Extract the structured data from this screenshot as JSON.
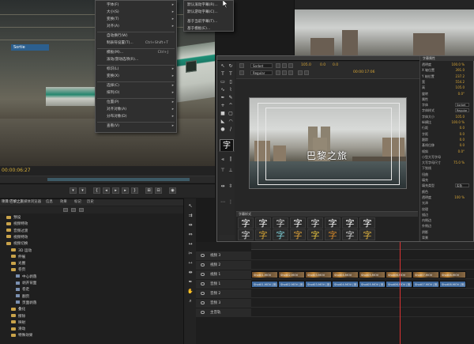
{
  "source_monitor": {
    "sign_text": "Sortie",
    "timecode": "00:00:06:27"
  },
  "context_menu": {
    "items": [
      {
        "label": "字体(F)",
        "shortcut": "",
        "submenu": true
      },
      {
        "label": "大小(S)",
        "shortcut": "",
        "submenu": true
      },
      {
        "label": "变换(T)",
        "shortcut": "",
        "submenu": true
      },
      {
        "label": "对齐(A)",
        "shortcut": "",
        "submenu": true
      },
      {
        "label": "自动换行(W)",
        "shortcut": "",
        "submenu": false
      },
      {
        "label": "制表符设置(T)...",
        "shortcut": "Ctrl+Shift+T",
        "submenu": false
      },
      {
        "label": "模板(M)...",
        "shortcut": "Ctrl+J",
        "submenu": false
      },
      {
        "label": "滚动/游动选项(R)...",
        "shortcut": "",
        "submenu": false
      },
      {
        "label": "标识(L)",
        "shortcut": "",
        "submenu": true
      },
      {
        "label": "变换(X)",
        "shortcut": "",
        "submenu": true
      },
      {
        "label": "选择(C)",
        "shortcut": "",
        "submenu": true
      },
      {
        "label": "排列(O)",
        "shortcut": "",
        "submenu": true
      },
      {
        "label": "位置(P)",
        "shortcut": "",
        "submenu": true
      },
      {
        "label": "对齐对象(A)",
        "shortcut": "",
        "submenu": true
      },
      {
        "label": "分布对象(D)",
        "shortcut": "",
        "submenu": true
      },
      {
        "label": "查看(V)",
        "shortcut": "",
        "submenu": true
      }
    ]
  },
  "sub_menu": {
    "items": [
      {
        "label": "默认滚动字幕(R)..."
      },
      {
        "label": "默认游动字幕(C)..."
      },
      {
        "label": "基于当前字幕(T)..."
      },
      {
        "label": "基于模板(E)..."
      }
    ]
  },
  "title_designer": {
    "font_family": "Sorbet",
    "font_style": "Regular",
    "font_size": "105.0",
    "kerning": "0.0",
    "leading": "0.0",
    "timecode": "00:00:17:06",
    "canvas_text": "巴黎之旅",
    "style_glyph": "字",
    "styles_header": "字幕样式",
    "properties_header": "字幕属性",
    "properties": [
      {
        "label": "透明度",
        "value": "100.0 %"
      },
      {
        "label": "X 轴位置",
        "value": "391.0"
      },
      {
        "label": "Y 轴位置",
        "value": "237.2"
      },
      {
        "label": "宽",
        "value": "554.2"
      },
      {
        "label": "高",
        "value": "105.0"
      },
      {
        "label": "旋转",
        "value": "0.0°"
      },
      {
        "label": "属性",
        "value": ""
      },
      {
        "label": "字体",
        "value": "Sorbet"
      },
      {
        "label": "字体样式",
        "value": "Regular"
      },
      {
        "label": "字体大小",
        "value": "105.0"
      },
      {
        "label": "纵横比",
        "value": "100.0 %"
      },
      {
        "label": "行距",
        "value": "0.0"
      },
      {
        "label": "字距",
        "value": "0.0"
      },
      {
        "label": "跟踪",
        "value": "0.0"
      },
      {
        "label": "基线位移",
        "value": "0.0"
      },
      {
        "label": "倾斜",
        "value": "0.0°"
      },
      {
        "label": "小型大写字母",
        "value": ""
      },
      {
        "label": "大写字母尺寸",
        "value": "75.0 %"
      },
      {
        "label": "下划线",
        "value": ""
      },
      {
        "label": "扭曲",
        "value": ""
      },
      {
        "label": "填充",
        "value": ""
      },
      {
        "label": "填充类型",
        "value": "实色"
      },
      {
        "label": "颜色",
        "value": ""
      },
      {
        "label": "透明度",
        "value": "100 %"
      },
      {
        "label": "光泽",
        "value": ""
      },
      {
        "label": "纹理",
        "value": ""
      },
      {
        "label": "描边",
        "value": ""
      },
      {
        "label": "内侧边",
        "value": ""
      },
      {
        "label": "外侧边",
        "value": ""
      },
      {
        "label": "阴影",
        "value": ""
      },
      {
        "label": "背景",
        "value": ""
      }
    ]
  },
  "project_panel": {
    "tabs": [
      "项目:巴黎之旅",
      "媒体浏览器",
      "信息",
      "效果",
      "标记",
      "历史"
    ],
    "folders": [
      {
        "label": "预设",
        "indent": 0,
        "type": "folder"
      },
      {
        "label": "视频特效",
        "indent": 0,
        "type": "folder"
      },
      {
        "label": "音频过渡",
        "indent": 0,
        "type": "folder"
      },
      {
        "label": "视频特效",
        "indent": 0,
        "type": "folder"
      },
      {
        "label": "视频切换",
        "indent": 0,
        "type": "folder"
      },
      {
        "label": "3D 运动",
        "indent": 1,
        "type": "folder"
      },
      {
        "label": "伸展",
        "indent": 1,
        "type": "folder"
      },
      {
        "label": "光圈",
        "indent": 1,
        "type": "folder"
      },
      {
        "label": "卷页",
        "indent": 1,
        "type": "folder"
      },
      {
        "label": "中心剥落",
        "indent": 2,
        "type": "item"
      },
      {
        "label": "剥开背面",
        "indent": 2,
        "type": "item"
      },
      {
        "label": "卷走",
        "indent": 2,
        "type": "item"
      },
      {
        "label": "翻页",
        "indent": 2,
        "type": "item"
      },
      {
        "label": "页面剥落",
        "indent": 2,
        "type": "item"
      },
      {
        "label": "叠化",
        "indent": 1,
        "type": "folder"
      },
      {
        "label": "擦除",
        "indent": 1,
        "type": "folder"
      },
      {
        "label": "映射",
        "indent": 1,
        "type": "folder"
      },
      {
        "label": "滑动",
        "indent": 1,
        "type": "folder"
      },
      {
        "label": "特殊效果",
        "indent": 1,
        "type": "folder"
      }
    ]
  },
  "timeline": {
    "tracks": [
      {
        "label": "视频 3",
        "kind": "video"
      },
      {
        "label": "视频 2",
        "kind": "video"
      },
      {
        "label": "视频 1",
        "kind": "video"
      },
      {
        "label": "音频 1",
        "kind": "audio"
      },
      {
        "label": "音频 2",
        "kind": "audio"
      },
      {
        "label": "音频 3",
        "kind": "audio"
      },
      {
        "label": "主音轨",
        "kind": "master"
      }
    ],
    "video_clips": [
      "Shot01.MOV",
      "Shot02.MOV",
      "Shot03.MOV",
      "Shot04.MOV",
      "Shot05.MOV",
      "Shot06.MOV",
      "Shot07.MOV",
      "Shot08.MOV"
    ],
    "audio_clips": [
      "Shot01.MOV [音]",
      "Shot02.MOV [音]",
      "Shot03.MOV [音]",
      "Shot04.MOV [音]",
      "Shot05.MOV [音]",
      "Shot06.MOV [音]",
      "Shot07.MOV [音]",
      "Shot08.MOV [音]"
    ]
  },
  "colors": {
    "accent_value": "#d8a636",
    "playhead": "#dd3333",
    "audio_clip": "#3f6a9e"
  }
}
